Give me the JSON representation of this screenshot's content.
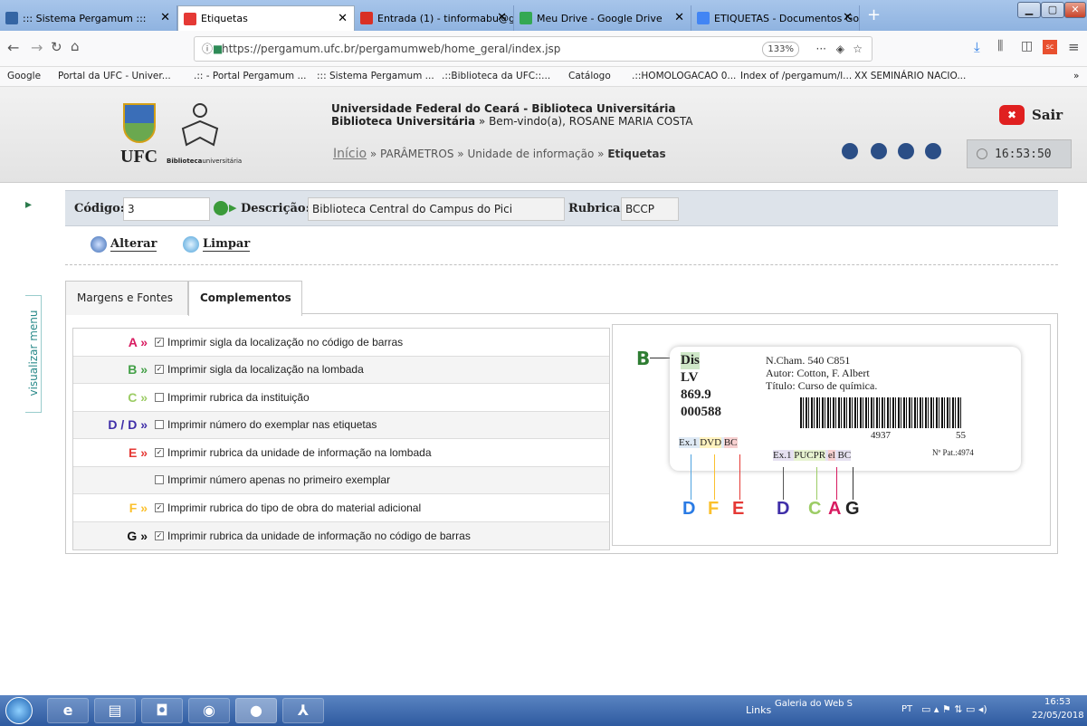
{
  "browser": {
    "tabs": [
      {
        "title": "::: Sistema Pergamum :::",
        "color": "#3465a4"
      },
      {
        "title": "Etiquetas",
        "color": "#e53935"
      },
      {
        "title": "Entrada (1) - tinformabu@gma",
        "color": "#d93025"
      },
      {
        "title": "Meu Drive - Google Drive",
        "color": "#34a853"
      },
      {
        "title": "ETIQUETAS - Documentos Goo",
        "color": "#4285f4"
      }
    ],
    "url": "https://pergamum.ufc.br/pergamumweb/home_geral/index.jsp",
    "url_host": "pergamum.ufc.br",
    "zoom": "133%",
    "bookmarks": [
      "Google",
      "Portal da UFC - Univer...",
      ".:: - Portal Pergamum ...",
      "::: Sistema Pergamum ...",
      ".::Biblioteca da UFC::...",
      "Catálogo",
      ".::HOMOLOGACAO 0...",
      "Index of /pergamum/l...",
      "XX SEMINÁRIO NACIO..."
    ]
  },
  "header": {
    "university": "Universidade Federal do Ceará - Biblioteca Universitária",
    "library": "Biblioteca Universitária",
    "welcome": "» Bem-vindo(a), ROSANE MARIA COSTA",
    "ufc_logo": "UFC",
    "bib_logo_bold": "Biblioteca",
    "bib_logo_rest": "universitária",
    "breadcrumb": {
      "home": "Início",
      "sep": "»",
      "p1": "PARÂMETROS",
      "p2": "Unidade de informação",
      "p3": "Etiquetas"
    },
    "logout": "Sair",
    "clock": "16:53:50"
  },
  "sidebar": {
    "menu_label": "visualizar menu"
  },
  "filter": {
    "codigo_label": "Código:",
    "codigo_value": "3",
    "descricao_label": "Descrição:",
    "descricao_value": "Biblioteca Central do Campus do Pici",
    "rubrica_label": "Rubrica:",
    "rubrica_value": "BCCP"
  },
  "actions": {
    "alterar": "Alterar",
    "limpar": "Limpar"
  },
  "tabs": [
    {
      "label": "Margens e Fontes"
    },
    {
      "label": "Complementos"
    }
  ],
  "options": [
    {
      "letter": "A »",
      "color": "#d81b60",
      "checked": true,
      "text": "Imprimir sigla da localização no código de barras"
    },
    {
      "letter": "B »",
      "color": "#43a047",
      "checked": true,
      "text": "Imprimir sigla da localização na lombada"
    },
    {
      "letter": "C »",
      "color": "#9ccc65",
      "checked": false,
      "text": "Imprimir rubrica da instituição"
    },
    {
      "letter": "D / D »",
      "color": "#3f2ea8",
      "checked": false,
      "text": "Imprimir número do exemplar nas etiquetas"
    },
    {
      "letter": "E »",
      "color": "#e53935",
      "checked": true,
      "text": "Imprimir rubrica da unidade de informação na lombada"
    },
    {
      "letter": "",
      "color": "#000000",
      "checked": false,
      "text": "Imprimir número apenas no primeiro exemplar"
    },
    {
      "letter": "F »",
      "color": "#fbc02d",
      "checked": true,
      "text": "Imprimir rubrica do tipo de obra do material adicional"
    },
    {
      "letter": "G »",
      "color": "#111111",
      "checked": true,
      "text": "Imprimir rubrica da unidade de informação no código de barras"
    }
  ],
  "preview": {
    "b_marker": "B",
    "spine": [
      "Dis",
      "LV",
      "869.9",
      "000588"
    ],
    "chamada": "N.Cham. 540 C851",
    "autor": "Autor: Cotton, F. Albert",
    "titulo": "Título: Curso de química.",
    "barcode_num1": "4937",
    "barcode_num2": "55",
    "pat": "Nº Pat.:4974",
    "left_tags": [
      "Ex.1",
      "DVD",
      "BC"
    ],
    "right_tags": [
      "Ex.1",
      "PUCPR",
      "el",
      "BC"
    ],
    "letters_left": [
      "D",
      "F",
      "E"
    ],
    "letters_right": [
      "D",
      "C",
      "A",
      "G"
    ]
  },
  "taskbar": {
    "links": "Links",
    "galeria": "Galeria do Web S",
    "lang": "PT",
    "time": "16:53",
    "date": "22/05/2018"
  }
}
